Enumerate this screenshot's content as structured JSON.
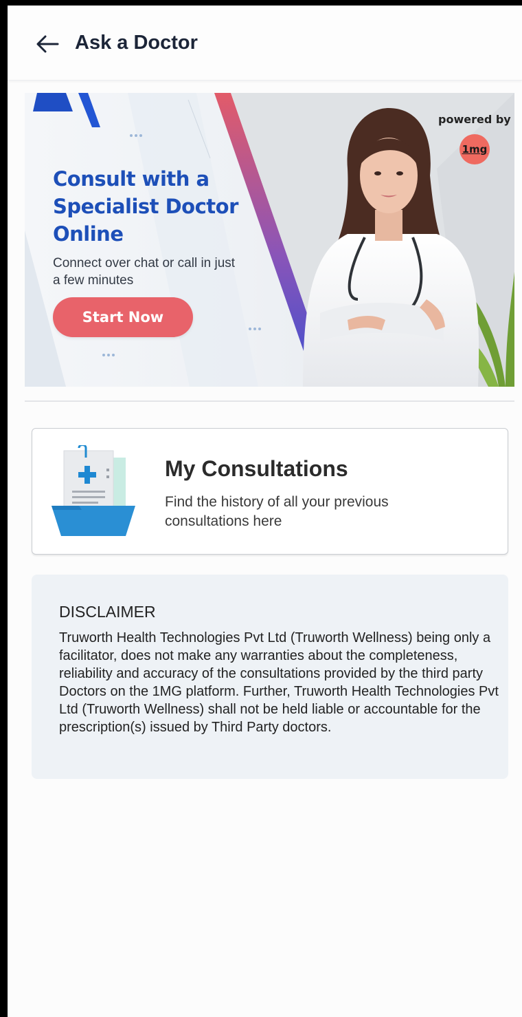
{
  "header": {
    "title": "Ask a Doctor",
    "back_icon": "arrow-left-icon"
  },
  "banner": {
    "title": "Consult with a Specialist Doctor Online",
    "subtitle": "Connect over chat or call in just a few minutes",
    "cta_label": "Start Now",
    "powered_by": "powered by",
    "partner_logo": "1mg",
    "colors": {
      "title": "#1d4fb8",
      "cta": "#e8636a",
      "logo": "#ef6a60"
    }
  },
  "consultations_card": {
    "title": "My Consultations",
    "description": "Find the history of all your previous consultations here",
    "icon": "medical-folder-icon"
  },
  "disclaimer": {
    "title": "DISCLAIMER",
    "body": "Truworth Health Technologies Pvt Ltd (Truworth Wellness) being only a facilitator, does not make any warranties about the completeness, reliability and accuracy of the consultations provided by the third party Doctors on the 1MG platform. Further, Truworth Health Technologies Pvt Ltd (Truworth Wellness) shall not be held liable or accountable for the prescription(s) issued by Third Party doctors."
  }
}
